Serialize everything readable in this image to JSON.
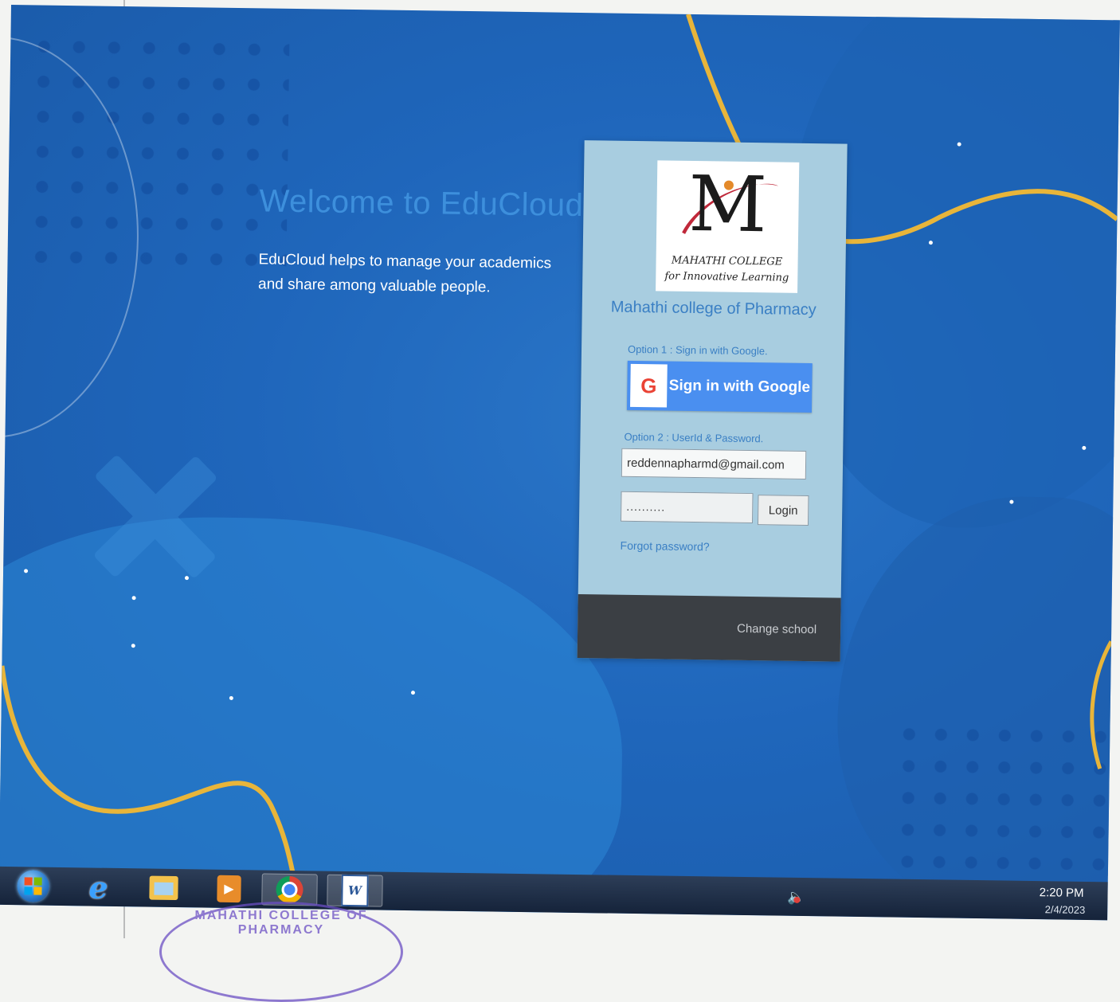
{
  "welcome": {
    "title": "Welcome to EduCloud",
    "description": "EduCloud helps to manage your academics and share among valuable people."
  },
  "login": {
    "logo_text_line1": "MAHATHI COLLEGE",
    "logo_text_line2": "for Innovative Learning",
    "college_name": "Mahathi college of Pharmacy",
    "option1_label": "Option 1 : Sign in with Google.",
    "google_button_label": "Sign in with Google",
    "option2_label": "Option 2 : UserId & Password.",
    "email_value": "reddennapharmd@gmail.com",
    "password_mask": "..........",
    "login_button": "Login",
    "forgot_password": "Forgot password?",
    "change_school": "Change school"
  },
  "taskbar": {
    "items": [
      "start-button",
      "internet-explorer",
      "file-explorer",
      "media-player",
      "chrome",
      "word"
    ],
    "time": "2:20 PM",
    "date": "2/4/2023"
  },
  "stamp": {
    "text": "MAHATHI COLLEGE OF PHARMACY"
  },
  "colors": {
    "background": "#1f66bb",
    "card": "#a8cde0",
    "accent": "#3a7fc4",
    "google_button": "#4a8ff0",
    "curve": "#e8b53a",
    "footer": "#3b3f44"
  }
}
